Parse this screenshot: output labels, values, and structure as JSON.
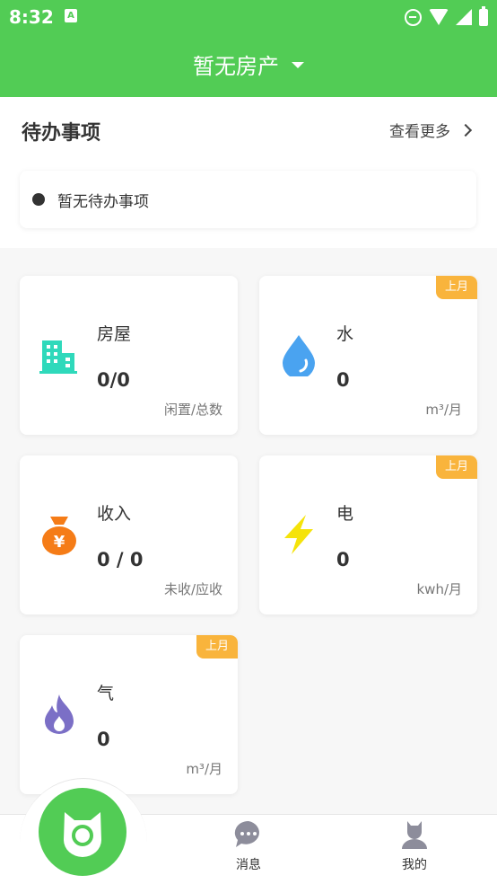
{
  "status_bar": {
    "time": "8:32",
    "app_icon_letter": "A"
  },
  "header": {
    "property_selector": "暂无房产"
  },
  "todo": {
    "title": "待办事项",
    "see_more": "查看更多",
    "empty_item": "暂无待办事项"
  },
  "stats": {
    "house": {
      "name": "房屋",
      "value": "0/0",
      "unit": "闲置/总数",
      "icon": "building-icon"
    },
    "water": {
      "name": "水",
      "value": "0",
      "unit": "m³/月",
      "badge": "上月",
      "icon": "water-drop-icon"
    },
    "income": {
      "name": "收入",
      "value": "0 / 0",
      "unit": "未收/应收",
      "icon": "money-bag-icon"
    },
    "electricity": {
      "name": "电",
      "value": "0",
      "unit": "kwh/月",
      "badge": "上月",
      "icon": "lightning-icon"
    },
    "gas": {
      "name": "气",
      "value": "0",
      "unit": "m³/月",
      "badge": "上月",
      "icon": "flame-icon"
    }
  },
  "nav": {
    "home_icon": "cat-logo-icon",
    "messages": "消息",
    "mine": "我的"
  },
  "colors": {
    "brand_green": "#52cc55",
    "badge_orange": "#f9b43c",
    "building_teal": "#2fd9bb",
    "water_blue": "#4aa3f0",
    "money_orange": "#f57c17",
    "bolt_yellow": "#f5e30a",
    "flame_purple": "#7b6fc6",
    "nav_gray": "#8d8d9b"
  }
}
